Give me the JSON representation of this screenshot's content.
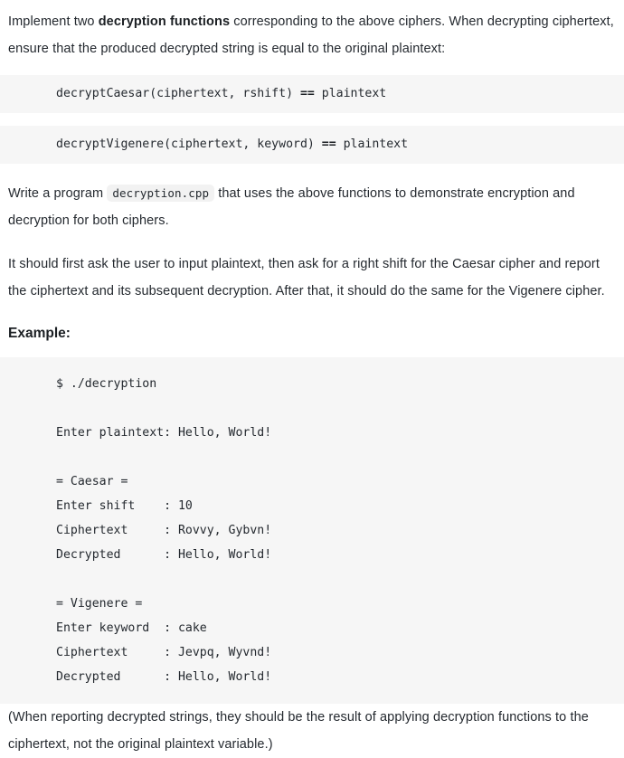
{
  "intro": {
    "part1": "Implement two ",
    "bold": "decryption functions",
    "part2": " corresponding to the above ciphers. When decrypting ciphertext, ensure that the produced decrypted string is equal to the original plaintext:"
  },
  "signatures": [
    {
      "call": "decryptCaesar(ciphertext, rshift) ",
      "operator": "==",
      "result": " plaintext"
    },
    {
      "call": "decryptVigenere(ciphertext, keyword) ",
      "operator": "==",
      "result": " plaintext"
    }
  ],
  "program_para": {
    "part1": "Write a program ",
    "code": "decryption.cpp",
    "part2": " that uses the above functions to demonstrate encryption and decryption for both ciphers."
  },
  "behaviour_para": "It should first ask the user to input plaintext, then ask for a right shift for the Caesar cipher and report the ciphertext and its subsequent decryption. After that, it should do the same for the Vigenere cipher.",
  "example_heading": "Example:",
  "terminal": {
    "lines": [
      "$ ./decryption",
      "",
      "Enter plaintext: Hello, World!",
      "",
      "= Caesar =",
      "Enter shift    : 10",
      "Ciphertext     : Rovvy, Gybvn!",
      "Decrypted      : Hello, World!",
      "",
      "= Vigenere =",
      "Enter keyword  : cake",
      "Ciphertext     : Jevpq, Wyvnd!",
      "Decrypted      : Hello, World!"
    ]
  },
  "note_para": "(When reporting decrypted strings, they should be the result of applying decryption functions to the ciphertext, not the original plaintext variable.)",
  "colors": {
    "text": "#24292f",
    "code_background": "#f6f6f6",
    "inline_code_background": "#f2f2f2",
    "page_background": "#ffffff"
  }
}
